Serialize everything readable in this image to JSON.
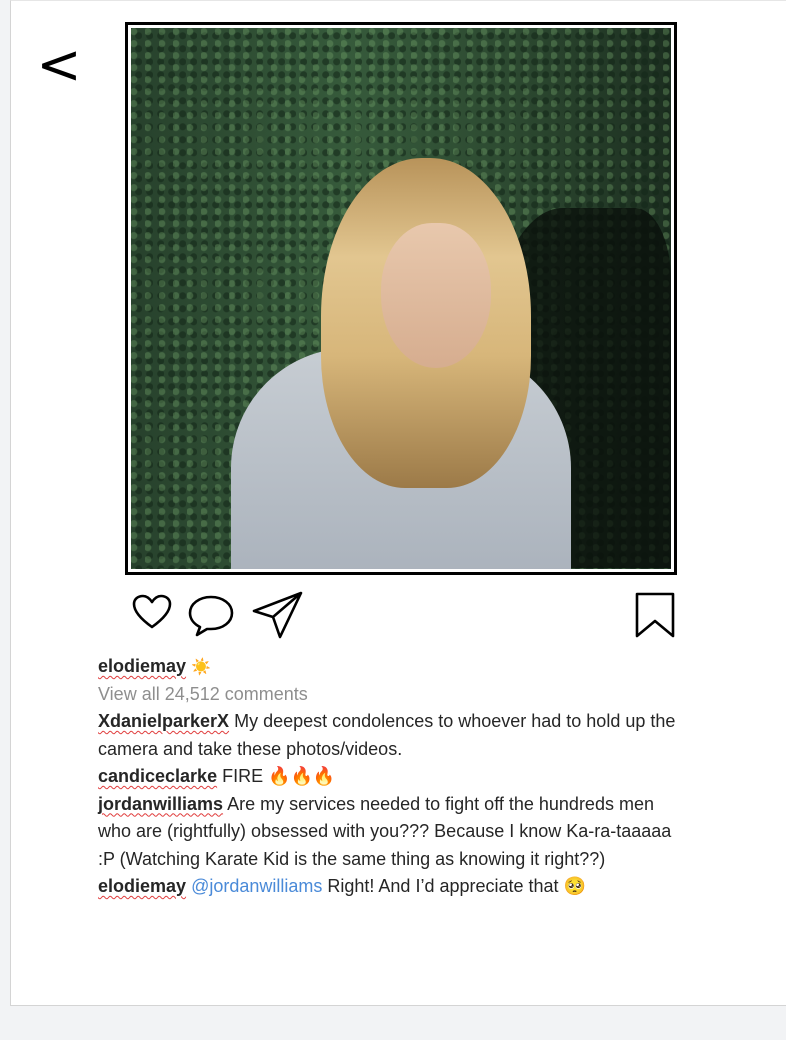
{
  "nav": {
    "back_label": "<"
  },
  "post": {
    "author": "elodiemay",
    "author_emoji": "☀️",
    "view_comments": "View all 24,512 comments",
    "image_alt": "Woman with long wavy blonde hair standing in front of a green hedge wall"
  },
  "icons": {
    "like": "heart-icon",
    "comment": "speech-bubble-icon",
    "share": "paper-plane-icon",
    "bookmark": "bookmark-icon"
  },
  "comments": [
    {
      "user": "XdanielparkerX",
      "text": "My deepest condolences to whoever had to hold up the camera and take these photos/videos."
    },
    {
      "user": "candiceclarke",
      "text": "FIRE 🔥🔥🔥"
    },
    {
      "user": "jordanwilliams",
      "text": "Are my services needed to fight off the hundreds men who are (rightfully) obsessed with you??? Because I know Ka-ra-taaaaa :P (Watching Karate Kid is the same thing as knowing it right??)"
    },
    {
      "user": "elodiemay",
      "mention": "@jordanwilliams",
      "text": "Right! And I’d appreciate that 🥺"
    }
  ],
  "colors": {
    "text": "#262626",
    "muted": "#8e8e8e",
    "mention": "#4a8ad8"
  }
}
